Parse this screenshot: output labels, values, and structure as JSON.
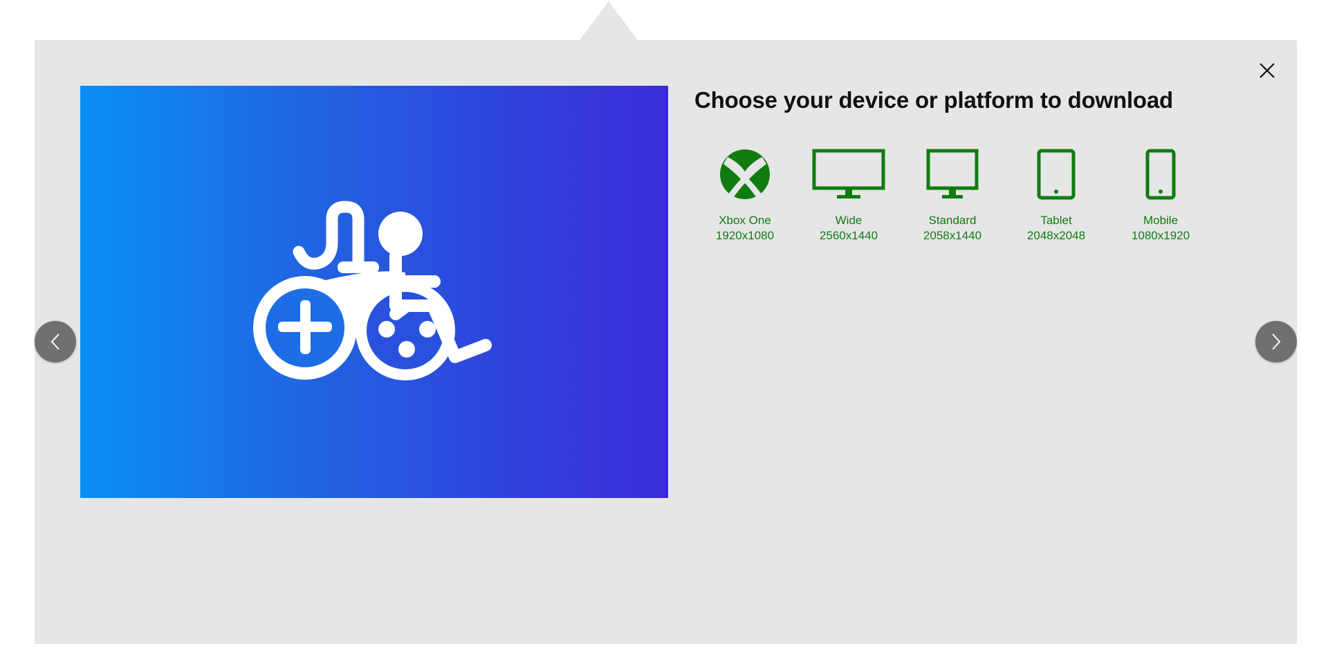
{
  "dialog": {
    "title": "Choose your device or platform to download"
  },
  "devices": [
    {
      "name": "Xbox One",
      "resolution": "1920x1080",
      "icon": "xbox-logo-icon"
    },
    {
      "name": "Wide",
      "resolution": "2560x1440",
      "icon": "wide-monitor-icon"
    },
    {
      "name": "Standard",
      "resolution": "2058x1440",
      "icon": "standard-monitor-icon"
    },
    {
      "name": "Tablet",
      "resolution": "2048x2048",
      "icon": "tablet-icon"
    },
    {
      "name": "Mobile",
      "resolution": "1080x1920",
      "icon": "mobile-phone-icon"
    }
  ],
  "colors": {
    "accent": "#107c10",
    "panel": "#e6e6e6",
    "nav_button": "#707070",
    "hero_start": "#0a8ff5",
    "hero_end": "#3a2bd6"
  },
  "icons": {
    "close": "close-icon",
    "prev": "chevron-left-icon",
    "next": "chevron-right-icon",
    "hero": "accessibility-controller-wheelchair-icon"
  }
}
